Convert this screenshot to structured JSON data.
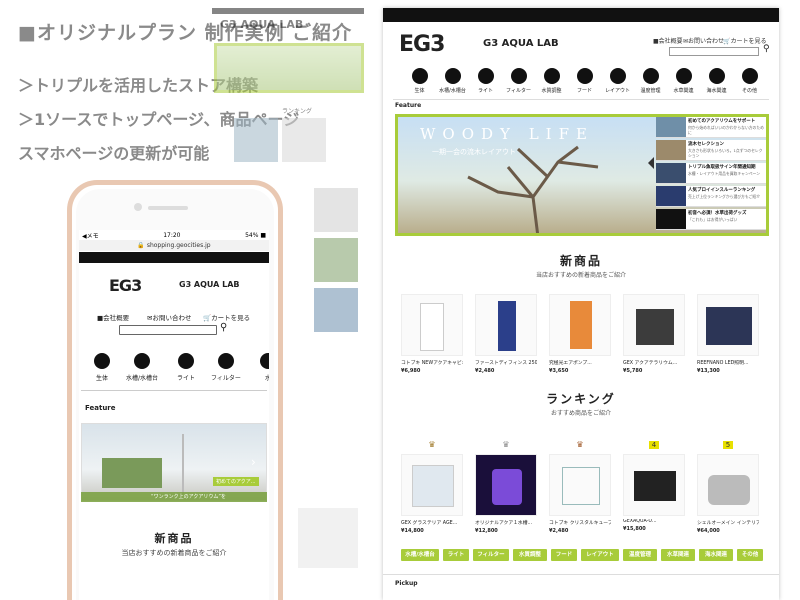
{
  "headline": "■オリジナルプラン 制作実例 ご紹介",
  "bullets": [
    "＞トリプルを活用したストア構築",
    "＞1ソースでトップページ、商品ページ",
    "スマホページの更新が可能"
  ],
  "colors": {
    "accent": "#a8cc3a",
    "text_gray": "#8a8a8a",
    "bar": "#111111"
  },
  "desktop": {
    "logo": "EG3",
    "brand": "G3 AQUA LAB",
    "utility_links": [
      "■会社概要",
      "✉お問い合わせ",
      "🛒カートを見る"
    ],
    "categories": [
      {
        "label": "生体",
        "icon": "fish-icon"
      },
      {
        "label": "水槽/水槽台",
        "icon": "tank-icon"
      },
      {
        "label": "ライト",
        "icon": "bulb-icon"
      },
      {
        "label": "フィルター",
        "icon": "filter-icon"
      },
      {
        "label": "水質調整",
        "icon": "water-drop-icon"
      },
      {
        "label": "フード",
        "icon": "food-icon"
      },
      {
        "label": "レイアウト",
        "icon": "driftwood-icon"
      },
      {
        "label": "温度管理",
        "icon": "thermometer-icon"
      },
      {
        "label": "水草関連",
        "icon": "plant-icon"
      },
      {
        "label": "海水関連",
        "icon": "clownfish-icon"
      },
      {
        "label": "その他",
        "icon": "misc-icon"
      }
    ],
    "feature_label": "Feature",
    "hero_title": "WOODY LIFE",
    "hero_subtitle": "一期一会の流木レイアウト",
    "side_banners": [
      {
        "title": "初めてのアクアリウムをサポート",
        "sub": "何から始めればいいのかわからない方のために"
      },
      {
        "title": "流木セレクション",
        "sub": "大きさも形状もいろいろ。1点ずつのセレクション"
      },
      {
        "title": "トリプル魚取扱サイン年間通知期",
        "sub": "水槽・レイアウト用品を買取キャンペーン"
      },
      {
        "title": "人気ブロイインスルーランキング",
        "sub": "売上げ上位ランキングから選び方もご紹介"
      },
      {
        "title": "初音へ必須！水草出荷グッズ",
        "sub": "「これも」はお得がいっぱい"
      }
    ],
    "new_title": "新商品",
    "new_sub": "当店おすすめの新着商品をご紹介",
    "new_products": [
      {
        "name": "コトブキ NEWアクアキャビネット",
        "price": "¥6,980"
      },
      {
        "name": "ファーストディフィンス 250ml...",
        "price": "¥2,480"
      },
      {
        "name": "究極光エアポンプ...",
        "price": "¥3,650"
      },
      {
        "name": "GEX アクアテラリウム...",
        "price": "¥5,780"
      },
      {
        "name": "REEFNANO LED照明...",
        "price": "¥13,300"
      }
    ],
    "ranking_title": "ランキング",
    "ranking_sub": "おすすめ商品をご紹介",
    "ranking_marks": [
      "♛",
      "♛",
      "♛",
      "4",
      "5"
    ],
    "ranking_products": [
      {
        "name": "GEX グラステリア AGE...",
        "price": "¥14,800"
      },
      {
        "name": "オリジナルアクア１水槽...",
        "price": "¥12,800"
      },
      {
        "name": "コトブキ クリスタルキューブ...",
        "price": "¥2,480"
      },
      {
        "name": "GEXAQUA-U...",
        "price": "¥15,800"
      },
      {
        "name": "シェルオーメイン インテリア水槽...",
        "price": "¥64,000"
      }
    ],
    "chips": [
      "水槽/水槽台",
      "ライト",
      "フィルター",
      "水質調整",
      "フード",
      "レイアウト",
      "温度管理",
      "水草関連",
      "海水関連",
      "その他"
    ],
    "pickup_label": "Pickup"
  },
  "phone": {
    "status_left": "◀メモ",
    "status_time": "17:20",
    "status_right": "54% ■",
    "url": "shopping.geocities.jp",
    "logo": "EG3",
    "brand": "G3 AQUA LAB",
    "utility_links": [
      "■会社概要",
      "✉お問い合わせ",
      "🛒カートを見る"
    ],
    "categories": [
      {
        "label": "生体",
        "icon": "fish-icon"
      },
      {
        "label": "水槽/水槽台",
        "icon": "tank-icon"
      },
      {
        "label": "ライト",
        "icon": "bulb-icon"
      },
      {
        "label": "フィルター",
        "icon": "filter-icon"
      },
      {
        "label": "水",
        "icon": "misc-icon"
      }
    ],
    "feature_label": "Feature",
    "hero_caption": "“ワンランク上のアクアリウム”を",
    "hero_tag": "初めてのアクア...",
    "new_title": "新商品",
    "new_sub": "当店おすすめの新着商品をご紹介"
  },
  "middle_page": {
    "logo": "G3 AQUA LAB",
    "ranking_label": "ランキング"
  }
}
